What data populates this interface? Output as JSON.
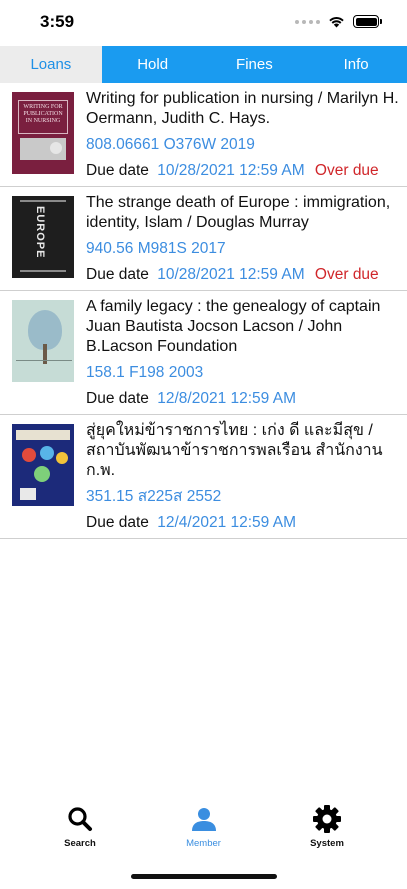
{
  "status_bar": {
    "time": "3:59"
  },
  "tabs": [
    {
      "label": "Loans",
      "active": true
    },
    {
      "label": "Hold",
      "active": false
    },
    {
      "label": "Fines",
      "active": false
    },
    {
      "label": "Info",
      "active": false
    }
  ],
  "loans": [
    {
      "title": "Writing for publication in nursing /  Marilyn H. Oermann, Judith C. Hays.",
      "call_number": "808.06661 O376W 2019",
      "due_label": "Due date",
      "due_date": "10/28/2021 12:59 AM",
      "status": "Over due",
      "cover_text": "WRITING FOR PUBLICATION IN NURSING"
    },
    {
      "title": "The strange death of Europe :  immigration, identity, Islam /  Douglas Murray",
      "call_number": "940.56 M981S 2017",
      "due_label": "Due date",
      "due_date": "10/28/2021 12:59 AM",
      "status": "Over due",
      "cover_text": "EUROPE"
    },
    {
      "title": "A family legacy :  the genealogy of captain Juan Bautista Jocson Lacson /  John B.Lacson Foundation",
      "call_number": "158.1 F198 2003",
      "due_label": "Due date",
      "due_date": "12/8/2021 12:59 AM",
      "status": ""
    },
    {
      "title": "สู่ยุคใหม่ข้าราชการไทย : เก่ง ดี และมีสุข / สถาบันพัฒนาข้าราชการพลเรือน สำนักงาน ก.พ.",
      "call_number": "351.15 ส225ส 2552",
      "due_label": "Due date",
      "due_date": "12/4/2021 12:59 AM",
      "status": ""
    }
  ],
  "bottom_nav": [
    {
      "label": "Search",
      "icon": "search-icon",
      "active": false
    },
    {
      "label": "Member",
      "icon": "person-icon",
      "active": true
    },
    {
      "label": "System",
      "icon": "gear-icon",
      "active": false
    }
  ],
  "colors": {
    "tab_bar": "#1a9bf0",
    "link": "#3c8de0",
    "overdue": "#d0262a"
  }
}
